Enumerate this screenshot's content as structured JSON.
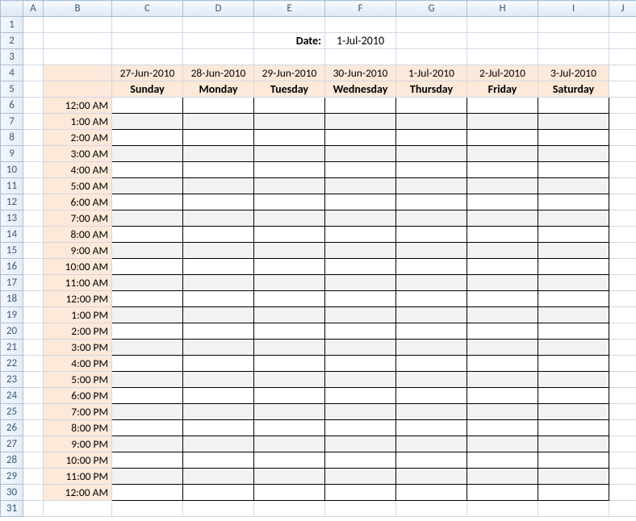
{
  "date_label": "Date:",
  "date_value": "1-Jul-2010",
  "columns": [
    "A",
    "B",
    "C",
    "D",
    "E",
    "F",
    "G",
    "H",
    "I",
    "J"
  ],
  "row_numbers": [
    "1",
    "2",
    "3",
    "4",
    "5",
    "6",
    "7",
    "8",
    "9",
    "10",
    "11",
    "12",
    "13",
    "14",
    "15",
    "16",
    "17",
    "18",
    "19",
    "20",
    "21",
    "22",
    "23",
    "24",
    "25",
    "26",
    "27",
    "28",
    "29",
    "30",
    "31"
  ],
  "days": [
    {
      "date": "27-Jun-2010",
      "name": "Sunday"
    },
    {
      "date": "28-Jun-2010",
      "name": "Monday"
    },
    {
      "date": "29-Jun-2010",
      "name": "Tuesday"
    },
    {
      "date": "30-Jun-2010",
      "name": "Wednesday"
    },
    {
      "date": "1-Jul-2010",
      "name": "Thursday"
    },
    {
      "date": "2-Jul-2010",
      "name": "Friday"
    },
    {
      "date": "3-Jul-2010",
      "name": "Saturday"
    }
  ],
  "times": [
    "12:00 AM",
    "1:00 AM",
    "2:00 AM",
    "3:00 AM",
    "4:00 AM",
    "5:00 AM",
    "6:00 AM",
    "7:00 AM",
    "8:00 AM",
    "9:00 AM",
    "10:00 AM",
    "11:00 AM",
    "12:00 PM",
    "1:00 PM",
    "2:00 PM",
    "3:00 PM",
    "4:00 PM",
    "5:00 PM",
    "6:00 PM",
    "7:00 PM",
    "8:00 PM",
    "9:00 PM",
    "10:00 PM",
    "11:00 PM",
    "12:00 AM"
  ]
}
